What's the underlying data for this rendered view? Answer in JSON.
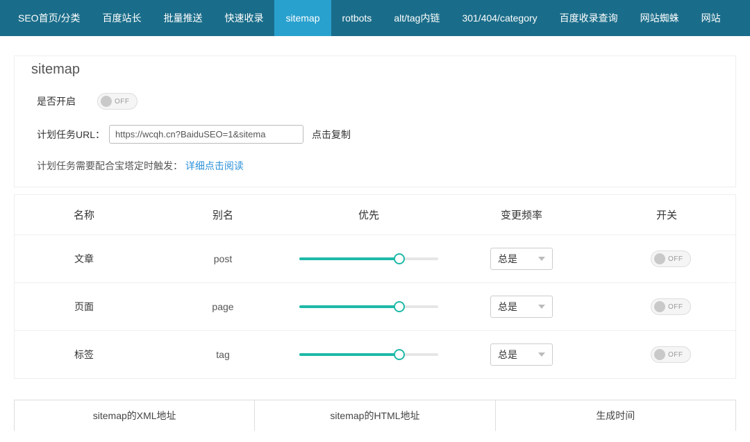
{
  "nav": {
    "items": [
      {
        "label": "SEO首页/分类",
        "active": false
      },
      {
        "label": "百度站长",
        "active": false
      },
      {
        "label": "批量推送",
        "active": false
      },
      {
        "label": "快速收录",
        "active": false
      },
      {
        "label": "sitemap",
        "active": true
      },
      {
        "label": "rotbots",
        "active": false
      },
      {
        "label": "alt/tag内链",
        "active": false
      },
      {
        "label": "301/404/category",
        "active": false
      },
      {
        "label": "百度收录查询",
        "active": false
      },
      {
        "label": "网站蜘蛛",
        "active": false
      },
      {
        "label": "网站",
        "active": false
      }
    ]
  },
  "panel": {
    "title": "sitemap",
    "enable_label": "是否开启",
    "enable_state": "OFF",
    "url_label": "计划任务URL：",
    "url_value": "https://wcqh.cn?BaiduSEO=1&sitema",
    "copy_label": "点击复制",
    "note_prefix": "计划任务需要配合宝塔定时触发：",
    "note_link": "详细点击阅读"
  },
  "table": {
    "headers": {
      "name": "名称",
      "alias": "别名",
      "priority": "优先",
      "freq": "变更频率",
      "switch": "开关"
    },
    "freq_option": "总是",
    "off_label": "OFF",
    "rows": [
      {
        "name": "文章",
        "alias": "post",
        "priority_pct": 72
      },
      {
        "name": "页面",
        "alias": "page",
        "priority_pct": 72
      },
      {
        "name": "标签",
        "alias": "tag",
        "priority_pct": 72
      }
    ]
  },
  "bottom": {
    "cols": {
      "xml": "sitemap的XML地址",
      "html": "sitemap的HTML地址",
      "time": "生成时间"
    }
  }
}
